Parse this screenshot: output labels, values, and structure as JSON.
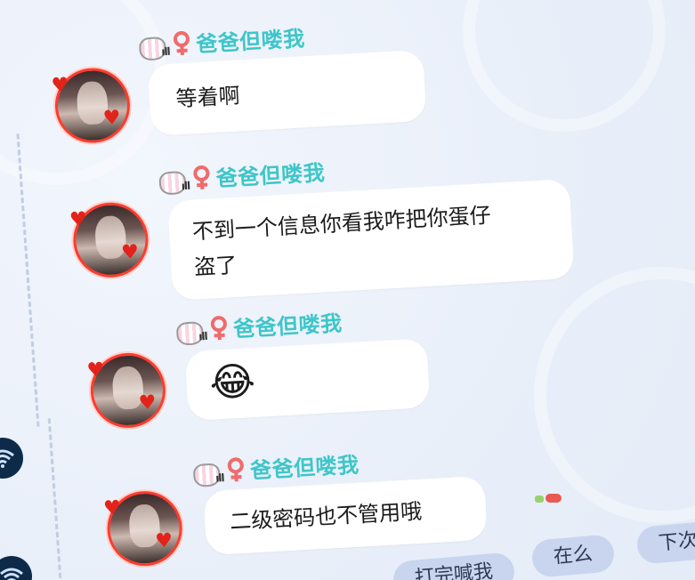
{
  "colors": {
    "nickname": "#3ec6c9",
    "bubble": "#ffffff",
    "avatar_ring": "#ff3b30",
    "chip_bg": "#c9d5ef",
    "background": "#eaf1fb"
  },
  "messages": [
    {
      "sender": {
        "nickname": "爸爸但喽我",
        "level_icon": "level-cat-badge-icon",
        "level_bars": "ıll",
        "gender_icon": "female-symbol-icon",
        "avatar_icon": "user-avatar-icon"
      },
      "text": "等着啊"
    },
    {
      "sender": {
        "nickname": "爸爸但喽我",
        "level_icon": "level-cat-badge-icon",
        "level_bars": "ıll",
        "gender_icon": "female-symbol-icon",
        "avatar_icon": "user-avatar-icon"
      },
      "text_line1": "不到一个信息你看我咋把你蛋仔",
      "text_line2": "盗了"
    },
    {
      "sender": {
        "nickname": "爸爸但喽我",
        "level_icon": "level-cat-badge-icon",
        "level_bars": "ıll",
        "gender_icon": "female-symbol-icon",
        "avatar_icon": "user-avatar-icon"
      },
      "emoji": "😂"
    },
    {
      "sender": {
        "nickname": "爸爸但喽我",
        "level_icon": "level-cat-badge-icon",
        "level_bars": "ıll",
        "gender_icon": "female-symbol-icon",
        "avatar_icon": "user-avatar-icon"
      },
      "text": "二级密码也不管用哦"
    }
  ],
  "quick_replies": [
    {
      "label": "打完喊我"
    },
    {
      "label": "在么"
    },
    {
      "label": "下次再"
    }
  ],
  "left_buttons": [
    {
      "icon": "wifi-icon"
    },
    {
      "icon": "wifi-icon"
    }
  ]
}
